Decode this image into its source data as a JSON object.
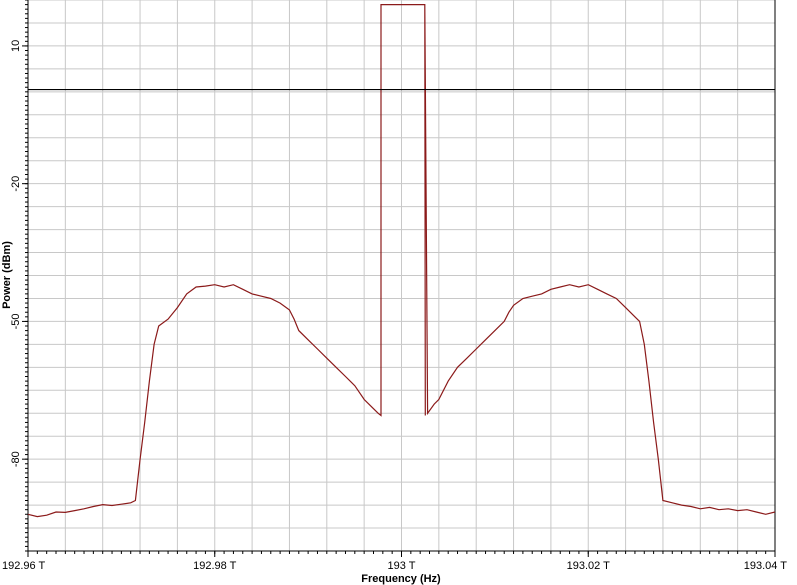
{
  "chart_data": {
    "type": "line",
    "title": "",
    "xlabel": "Frequency (Hz)",
    "ylabel": "Power (dBm)",
    "x_unit": "THz",
    "xlim": [
      192.96,
      193.04
    ],
    "ylim": [
      -100,
      20
    ],
    "x_tick_values": [
      192.96,
      192.98,
      193.0,
      193.02,
      193.04
    ],
    "x_tick_labels": [
      "192.96 T",
      "192.98 T",
      "193 T",
      "193.02 T",
      "193.04 T"
    ],
    "y_tick_values": [
      10,
      -20,
      -50,
      -80
    ],
    "y_tick_labels": [
      "10",
      "-20",
      "-50",
      "-80"
    ],
    "grid": true,
    "reference_line_y": 0.5,
    "colors": {
      "series": "#8b1a1a",
      "reference": "#000000",
      "grid": "#c8c8c8"
    },
    "series": [
      {
        "x": [
          192.96,
          192.961,
          192.962,
          192.963,
          192.964,
          192.965,
          192.966,
          192.967,
          192.968,
          192.969,
          192.97,
          192.971,
          192.9715,
          192.972,
          192.9725,
          192.973,
          192.9735,
          192.974,
          192.975,
          192.976,
          192.977,
          192.978,
          192.979,
          192.98,
          192.981,
          192.982,
          192.983,
          192.984,
          192.985,
          192.986,
          192.987,
          192.988,
          192.9885,
          192.989,
          192.99,
          192.991,
          192.992,
          192.993,
          192.994,
          192.995,
          192.996,
          192.997,
          192.9975,
          192.9978,
          192.9978,
          192.998,
          193.0025,
          193.00255,
          193.0025,
          193.0028,
          193.0035,
          193.004,
          193.005,
          193.006,
          193.007,
          193.008,
          193.009,
          193.01,
          193.011,
          193.0115,
          193.012,
          193.013,
          193.014,
          193.015,
          193.016,
          193.017,
          193.018,
          193.019,
          193.02,
          193.021,
          193.022,
          193.023,
          193.024,
          193.025,
          193.0255,
          193.026,
          193.0265,
          193.027,
          193.0275,
          193.028,
          193.029,
          193.03,
          193.031,
          193.032,
          193.033,
          193.034,
          193.035,
          193.036,
          193.037,
          193.038,
          193.039,
          193.04
        ],
        "y": [
          -92,
          -92.5,
          -92.2,
          -91.5,
          -91.6,
          -91.2,
          -90.8,
          -90.3,
          -89.9,
          -90.1,
          -89.8,
          -89.5,
          -89,
          -80,
          -72,
          -63,
          -55,
          -51,
          -49.5,
          -47,
          -44,
          -42.5,
          -42.3,
          -42,
          -42.5,
          -42,
          -43,
          -44,
          -44.5,
          -45,
          -46,
          -47.5,
          -49.5,
          -52,
          -54,
          -56,
          -58,
          -60,
          -62,
          -64,
          -67,
          -69,
          -70,
          -70.5,
          19,
          19,
          19,
          -70.5,
          19,
          -70,
          -68,
          -67,
          -63,
          -60,
          -58,
          -56,
          -54,
          -52,
          -50,
          -48,
          -46.5,
          -45,
          -44.5,
          -44,
          -43,
          -42.5,
          -42,
          -42.5,
          -42,
          -43,
          -44,
          -45,
          -47,
          -49,
          -50,
          -55,
          -63,
          -72,
          -80,
          -89,
          -89.5,
          -90,
          -90.3,
          -90.8,
          -90.5,
          -91,
          -90.8,
          -91.2,
          -91,
          -91.5,
          -92,
          -91.5
        ]
      }
    ]
  },
  "ui": {
    "x_axis_title": "Frequency (Hz)",
    "y_axis_title": "Power (dBm)"
  }
}
